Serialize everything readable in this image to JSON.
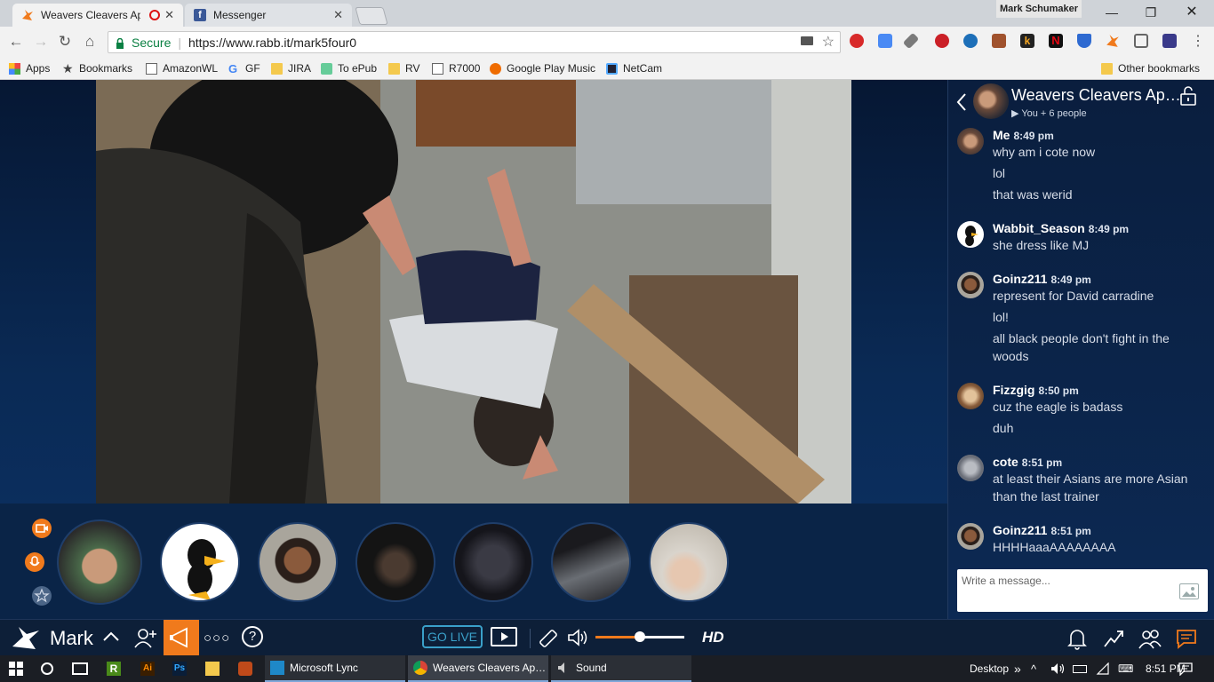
{
  "browser": {
    "tabs": [
      {
        "title": "Weavers Cleavers App",
        "active": true
      },
      {
        "title": "Messenger",
        "active": false
      }
    ],
    "profile_name": "Mark Schumaker",
    "address": {
      "secure_label": "Secure",
      "url": "https://www.rabb.it/mark5four0"
    },
    "bookmarks": [
      "Apps",
      "Bookmarks",
      "AmazonWL",
      "GF",
      "JIRA",
      "To ePub",
      "RV",
      "R7000",
      "Google Play Music",
      "NetCam"
    ],
    "other_bookmarks": "Other bookmarks"
  },
  "room": {
    "title": "Weavers Cleavers Ap…",
    "subtitle": "▶ You + 6 people"
  },
  "chat": {
    "messages": [
      {
        "name": "Me",
        "time": "8:49 pm",
        "lines": [
          "why am i cote now",
          "lol",
          "that was werid"
        ]
      },
      {
        "name": "Wabbit_Season",
        "time": "8:49 pm",
        "lines": [
          "she dress like MJ"
        ]
      },
      {
        "name": "Goinz211",
        "time": "8:49 pm",
        "lines": [
          "represent for David carradine",
          "lol!",
          "all black people don't fight in the woods"
        ]
      },
      {
        "name": "Fizzgig",
        "time": "8:50 pm",
        "lines": [
          "cuz the eagle is badass",
          "duh"
        ]
      },
      {
        "name": "cote",
        "time": "8:51 pm",
        "lines": [
          "at least their Asians are more Asian than the last trainer"
        ]
      },
      {
        "name": "Goinz211",
        "time": "8:51 pm",
        "lines": [
          "HHHHaaaAAAAAAAA"
        ]
      }
    ],
    "input_placeholder": "Write a message..."
  },
  "controls": {
    "user_label": "Mark",
    "go_live_label": "GO LIVE",
    "quality_label": "HD",
    "volume_level": 0.5
  },
  "taskbar": {
    "items": [
      "Microsoft Lync",
      "Weavers Cleavers Ap…",
      "Sound"
    ],
    "desktop_label": "Desktop",
    "clock": "8:51 PM"
  },
  "colors": {
    "accent": "#f07a1c",
    "live": "#3aa0c9"
  }
}
